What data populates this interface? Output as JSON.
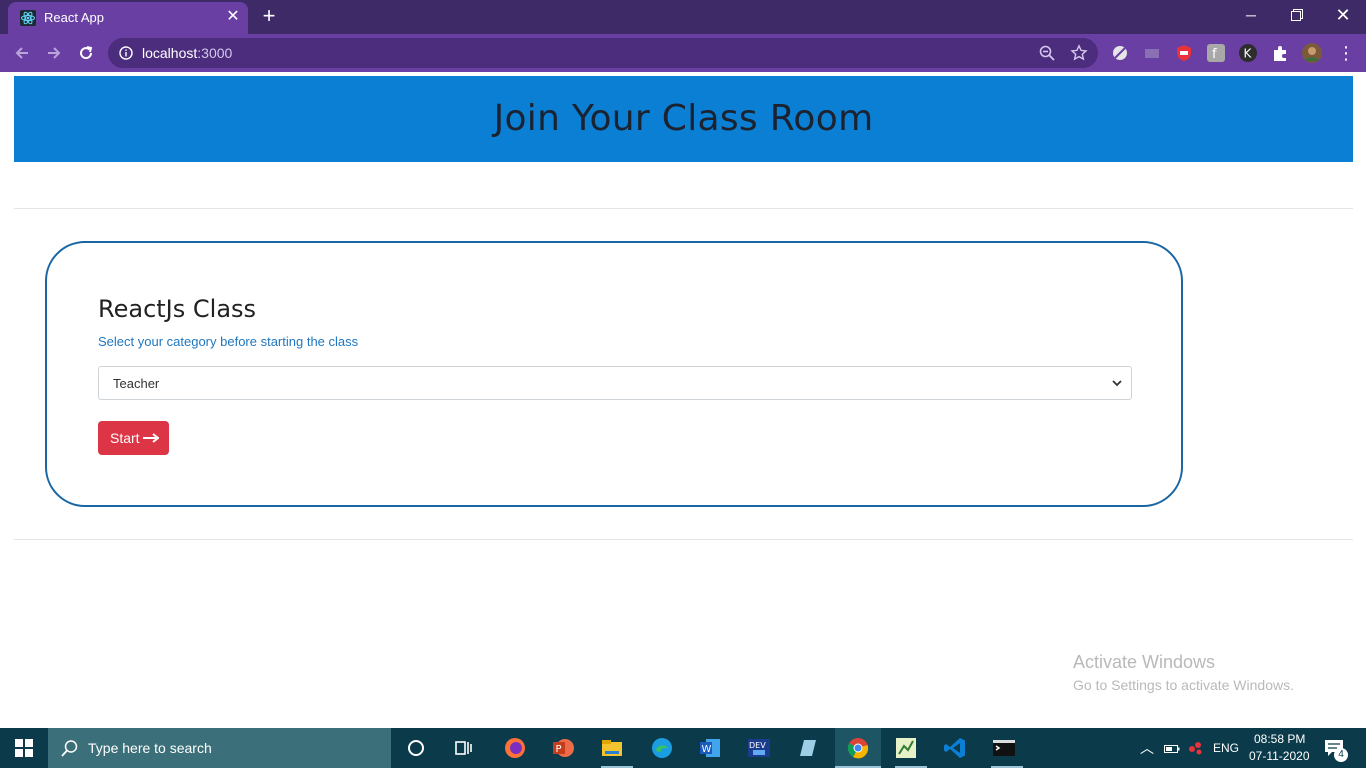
{
  "browser": {
    "tab_title": "React App",
    "url_host": "localhost",
    "url_port": ":3000"
  },
  "page": {
    "banner_title": "Join Your Class Room",
    "card_title": "ReactJs Class",
    "card_subtitle": "Select your category before starting the class",
    "category_select": {
      "selected": "Teacher"
    },
    "start_button_label": "Start"
  },
  "watermark": {
    "line1": "Activate Windows",
    "line2": "Go to Settings to activate Windows."
  },
  "taskbar": {
    "search_placeholder": "Type here to search",
    "language": "ENG",
    "time": "08:58 PM",
    "date": "07-11-2020",
    "notification_count": "4"
  },
  "colors": {
    "banner": "#0a7fd3",
    "card_border": "#1a66a3",
    "start_button": "#dc3545",
    "subtitle": "#1f78c1"
  }
}
